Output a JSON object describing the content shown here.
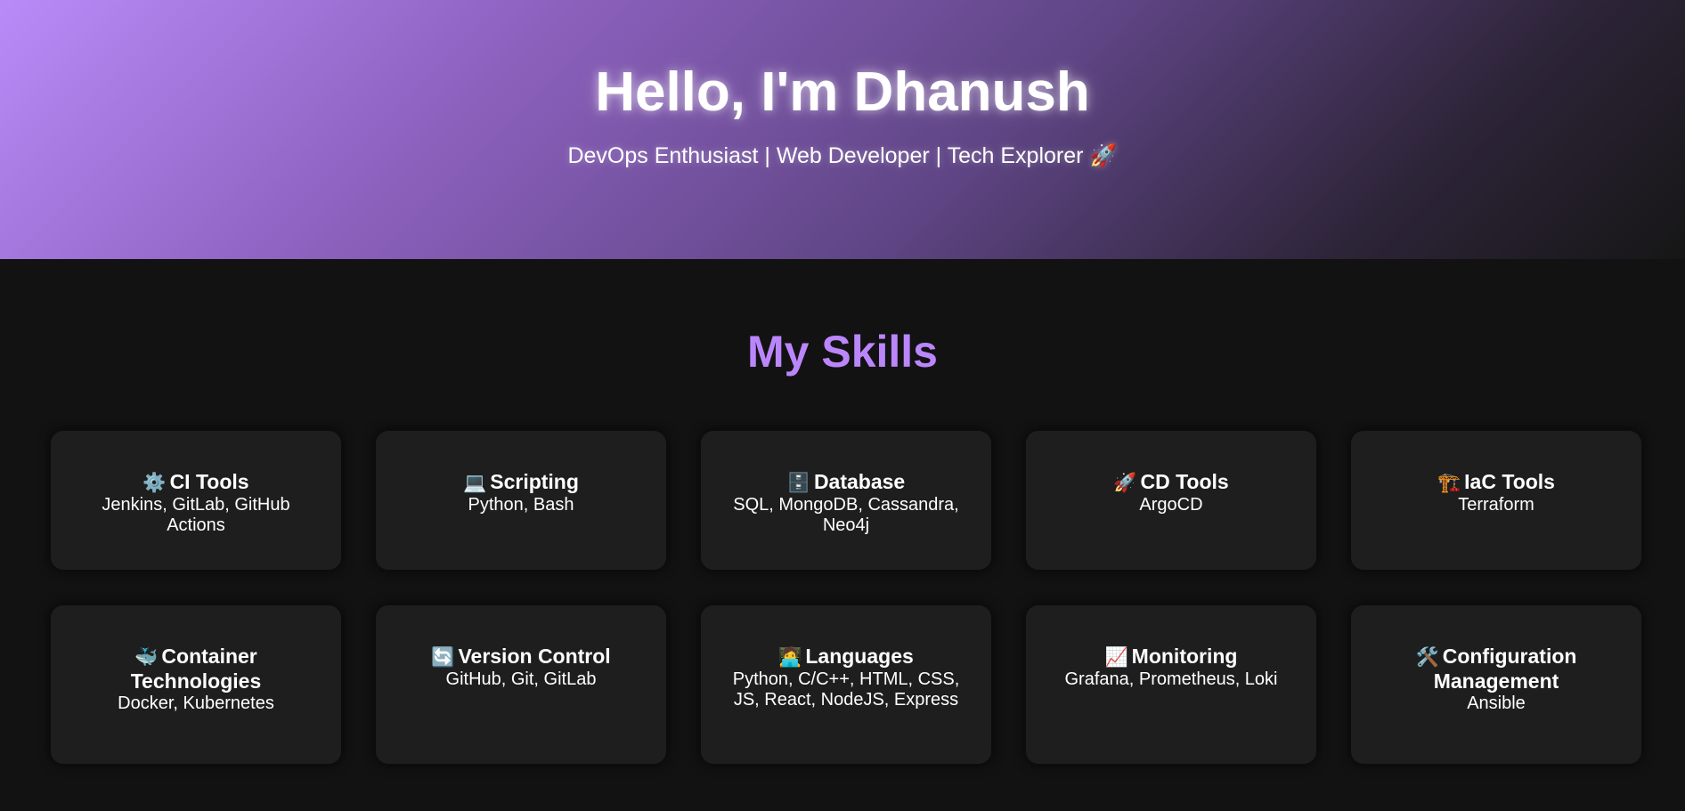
{
  "hero": {
    "title": "Hello, I'm Dhanush",
    "subtitle": "DevOps Enthusiast | Web Developer | Tech Explorer 🚀"
  },
  "skills": {
    "heading": "My Skills",
    "cards": [
      {
        "icon": "⚙️",
        "icon_name": "gear-icon",
        "title": "CI Tools",
        "desc": "Jenkins, GitLab, GitHub Actions"
      },
      {
        "icon": "💻",
        "icon_name": "laptop-icon",
        "title": "Scripting",
        "desc": "Python, Bash"
      },
      {
        "icon": "🗄️",
        "icon_name": "database-icon",
        "title": "Database",
        "desc": "SQL, MongoDB, Cassandra, Neo4j"
      },
      {
        "icon": "🚀",
        "icon_name": "rocket-icon",
        "title": "CD Tools",
        "desc": "ArgoCD"
      },
      {
        "icon": "🏗️",
        "icon_name": "construction-icon",
        "title": "IaC Tools",
        "desc": "Terraform"
      },
      {
        "icon": "🐳",
        "icon_name": "whale-icon",
        "title": "Container Technologies",
        "desc": "Docker, Kubernetes"
      },
      {
        "icon": "🔄",
        "icon_name": "refresh-icon",
        "title": "Version Control",
        "desc": "GitHub, Git, GitLab"
      },
      {
        "icon": "🧑‍💻",
        "icon_name": "developer-icon",
        "title": "Languages",
        "desc": "Python, C/C++, HTML, CSS, JS, React, NodeJS, Express"
      },
      {
        "icon": "📈",
        "icon_name": "chart-icon",
        "title": "Monitoring",
        "desc": "Grafana, Prometheus, Loki"
      },
      {
        "icon": "🛠️",
        "icon_name": "tools-icon",
        "title": "Configuration Management",
        "desc": "Ansible"
      }
    ]
  },
  "colors": {
    "accent": "#bb86fc",
    "background": "#121212",
    "card": "#1e1e1e"
  }
}
